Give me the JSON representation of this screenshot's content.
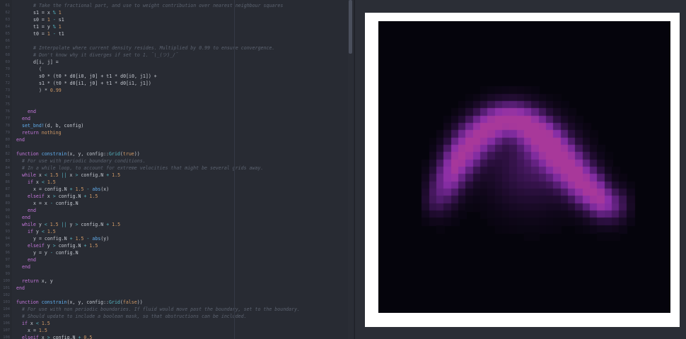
{
  "editor": {
    "lines": [
      {
        "n": "61",
        "t": [
          [
            "cm",
            "# Take the fractional part, and use to weight contribution over nearest neighbour squares"
          ]
        ],
        "i": 6
      },
      {
        "n": "62",
        "t": [
          [
            "",
            "s1 = x "
          ],
          [
            "op",
            "%"
          ],
          [
            "num",
            " 1"
          ]
        ],
        "i": 6
      },
      {
        "n": "63",
        "t": [
          [
            "",
            "s0 = "
          ],
          [
            "num",
            "1"
          ],
          [
            "op",
            " - "
          ],
          [
            "",
            "s1"
          ]
        ],
        "i": 6
      },
      {
        "n": "64",
        "t": [
          [
            "",
            "t1 = y "
          ],
          [
            "op",
            "%"
          ],
          [
            "num",
            " 1"
          ]
        ],
        "i": 6
      },
      {
        "n": "65",
        "t": [
          [
            "",
            "t0 = "
          ],
          [
            "num",
            "1"
          ],
          [
            "op",
            " - "
          ],
          [
            "",
            "t1"
          ]
        ],
        "i": 6
      },
      {
        "n": "66",
        "t": [],
        "i": 0
      },
      {
        "n": "67",
        "t": [
          [
            "cm",
            "# Interpolate where current density resides. Multiplied by 0.99 to ensure convergence."
          ]
        ],
        "i": 6
      },
      {
        "n": "68",
        "t": [
          [
            "cm",
            "# Don't know why it diverges if set to 1. ¯\\_(ツ)_/¯"
          ]
        ],
        "i": 6
      },
      {
        "n": "69",
        "t": [
          [
            "",
            "d[i, j] ="
          ]
        ],
        "i": 6
      },
      {
        "n": "70",
        "t": [
          [
            "",
            "("
          ]
        ],
        "i": 8
      },
      {
        "n": "71",
        "t": [
          [
            "",
            "s0 * (t0 * d0[i0, j0] + t1 * d0[i0, j1]) +"
          ]
        ],
        "i": 8
      },
      {
        "n": "72",
        "t": [
          [
            "",
            "s1 * (t0 * d0[i1, j0] + t1 * d0[i1, j1])"
          ]
        ],
        "i": 8
      },
      {
        "n": "73",
        "t": [
          [
            "",
            ") * "
          ],
          [
            "num",
            "0.99"
          ]
        ],
        "i": 8
      },
      {
        "n": "74",
        "t": [],
        "i": 0
      },
      {
        "n": "75",
        "t": [],
        "i": 0
      },
      {
        "n": "76",
        "t": [
          [
            "kw",
            "end"
          ]
        ],
        "i": 4
      },
      {
        "n": "77",
        "t": [
          [
            "kw",
            "end"
          ]
        ],
        "i": 2
      },
      {
        "n": "78",
        "t": [
          [
            "fn",
            "set_bnd!"
          ],
          [
            "",
            "(d, b, config)"
          ]
        ],
        "i": 2
      },
      {
        "n": "79",
        "t": [
          [
            "kw",
            "return"
          ],
          [
            "num",
            " nothing"
          ]
        ],
        "i": 2
      },
      {
        "n": "80",
        "t": [
          [
            "kw",
            "end"
          ]
        ],
        "i": 0
      },
      {
        "n": "81",
        "t": [],
        "i": 0
      },
      {
        "n": "82",
        "t": [
          [
            "kw",
            "function "
          ],
          [
            "fn",
            "constrain"
          ],
          [
            "",
            "(x, y, config::"
          ],
          [
            "tp",
            "Grid"
          ],
          [
            "",
            "("
          ],
          [
            "num",
            "true"
          ],
          [
            "",
            "))"
          ]
        ],
        "i": 0
      },
      {
        "n": "83",
        "t": [
          [
            "cm",
            "# For use with periodic boundary conditions."
          ]
        ],
        "i": 2
      },
      {
        "n": "84",
        "t": [
          [
            "cm",
            "# In a while loop, to account for extreme velocities that might be several grids away."
          ]
        ],
        "i": 2
      },
      {
        "n": "85",
        "t": [
          [
            "kw",
            "while"
          ],
          [
            "",
            " x "
          ],
          [
            "op",
            "<"
          ],
          [
            "num",
            " 1.5"
          ],
          [
            "op",
            " || "
          ],
          [
            "",
            "x "
          ],
          [
            "op",
            ">"
          ],
          [
            "",
            " config.N "
          ],
          [
            "op",
            "+"
          ],
          [
            "num",
            " 1.5"
          ]
        ],
        "i": 2
      },
      {
        "n": "86",
        "t": [
          [
            "kw",
            "if"
          ],
          [
            "",
            " x "
          ],
          [
            "op",
            "<"
          ],
          [
            "num",
            " 1.5"
          ]
        ],
        "i": 4
      },
      {
        "n": "87",
        "t": [
          [
            "",
            "x = config.N "
          ],
          [
            "op",
            "+"
          ],
          [
            "num",
            " 1.5"
          ],
          [
            "op",
            " - "
          ],
          [
            "fn",
            "abs"
          ],
          [
            "",
            "(x)"
          ]
        ],
        "i": 6
      },
      {
        "n": "88",
        "t": [
          [
            "kw",
            "elseif"
          ],
          [
            "",
            " x "
          ],
          [
            "op",
            ">"
          ],
          [
            "",
            " config.N "
          ],
          [
            "op",
            "+"
          ],
          [
            "num",
            " 1.5"
          ]
        ],
        "i": 4
      },
      {
        "n": "89",
        "t": [
          [
            "",
            "x = x "
          ],
          [
            "op",
            "-"
          ],
          [
            "",
            " config.N"
          ]
        ],
        "i": 6
      },
      {
        "n": "90",
        "t": [
          [
            "kw",
            "end"
          ]
        ],
        "i": 4
      },
      {
        "n": "91",
        "t": [
          [
            "kw",
            "end"
          ]
        ],
        "i": 2
      },
      {
        "n": "92",
        "t": [
          [
            "kw",
            "while"
          ],
          [
            "",
            " y "
          ],
          [
            "op",
            "<"
          ],
          [
            "num",
            " 1.5"
          ],
          [
            "op",
            " || "
          ],
          [
            "",
            "y "
          ],
          [
            "op",
            ">"
          ],
          [
            "",
            " config.N "
          ],
          [
            "op",
            "+"
          ],
          [
            "num",
            " 1.5"
          ]
        ],
        "i": 2
      },
      {
        "n": "93",
        "t": [
          [
            "kw",
            "if"
          ],
          [
            "",
            " y "
          ],
          [
            "op",
            "<"
          ],
          [
            "num",
            " 1.5"
          ]
        ],
        "i": 4
      },
      {
        "n": "94",
        "t": [
          [
            "",
            "y = config.N "
          ],
          [
            "op",
            "+"
          ],
          [
            "num",
            " 1.5"
          ],
          [
            "op",
            " - "
          ],
          [
            "fn",
            "abs"
          ],
          [
            "",
            "(y)"
          ]
        ],
        "i": 6
      },
      {
        "n": "95",
        "t": [
          [
            "kw",
            "elseif"
          ],
          [
            "",
            " y "
          ],
          [
            "op",
            ">"
          ],
          [
            "",
            " config.N "
          ],
          [
            "op",
            "+"
          ],
          [
            "num",
            " 1.5"
          ]
        ],
        "i": 4
      },
      {
        "n": "96",
        "t": [
          [
            "",
            "y = y "
          ],
          [
            "op",
            "-"
          ],
          [
            "",
            " config.N"
          ]
        ],
        "i": 6
      },
      {
        "n": "97",
        "t": [
          [
            "kw",
            "end"
          ]
        ],
        "i": 4
      },
      {
        "n": "98",
        "t": [
          [
            "kw",
            "end"
          ]
        ],
        "i": 2
      },
      {
        "n": "99",
        "t": [],
        "i": 0
      },
      {
        "n": "100",
        "t": [
          [
            "kw",
            "return"
          ],
          [
            "",
            " x, y"
          ]
        ],
        "i": 2
      },
      {
        "n": "101",
        "t": [
          [
            "kw",
            "end"
          ]
        ],
        "i": 0
      },
      {
        "n": "102",
        "t": [],
        "i": 0
      },
      {
        "n": "103",
        "t": [
          [
            "kw",
            "function "
          ],
          [
            "fn",
            "constrain"
          ],
          [
            "",
            "(x, y, config::"
          ],
          [
            "tp",
            "Grid"
          ],
          [
            "",
            "("
          ],
          [
            "num",
            "false"
          ],
          [
            "",
            "))"
          ]
        ],
        "i": 0
      },
      {
        "n": "104",
        "t": [
          [
            "cm",
            "# For use with non periodic boundaries. If fluid would move past the boundary, set to the boundary."
          ]
        ],
        "i": 2
      },
      {
        "n": "105",
        "t": [
          [
            "cm",
            "# Should update to include a boolean mask, so that obstructions can be included."
          ]
        ],
        "i": 2
      },
      {
        "n": "106",
        "t": [
          [
            "kw",
            "if"
          ],
          [
            "",
            " x "
          ],
          [
            "op",
            "<"
          ],
          [
            "num",
            " 1.5"
          ]
        ],
        "i": 2
      },
      {
        "n": "107",
        "t": [
          [
            "",
            "x = "
          ],
          [
            "num",
            "1.5"
          ]
        ],
        "i": 4
      },
      {
        "n": "108",
        "t": [
          [
            "kw",
            "elseif"
          ],
          [
            "",
            " x "
          ],
          [
            "op",
            ">"
          ],
          [
            "",
            " config.N "
          ],
          [
            "op",
            "+"
          ],
          [
            "num",
            " 0.5"
          ]
        ],
        "i": 2
      }
    ]
  },
  "plot": {
    "type": "density heatmap",
    "grid_size": 40,
    "colormap": [
      "#05040c",
      "#2a0f3d",
      "#5a1f78",
      "#8a2fa8",
      "#a8389a"
    ]
  }
}
